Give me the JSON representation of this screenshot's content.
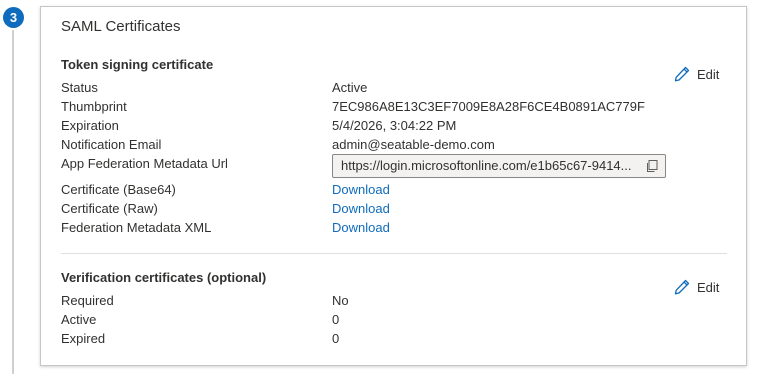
{
  "step": {
    "number": "3"
  },
  "card": {
    "title": "SAML Certificates"
  },
  "token_signing": {
    "title": "Token signing certificate",
    "edit_label": "Edit",
    "rows": [
      {
        "label": "Status",
        "value": "Active"
      },
      {
        "label": "Thumbprint",
        "value": "7EC986A8E13C3EF7009E8A28F6CE4B0891AC779F"
      },
      {
        "label": "Expiration",
        "value": "5/4/2026, 3:04:22 PM"
      },
      {
        "label": "Notification Email",
        "value": "admin@seatable-demo.com"
      }
    ],
    "metadata_url": {
      "label": "App Federation Metadata Url",
      "value": "https://login.microsoftonline.com/e1b65c67-9414..."
    },
    "downloads": [
      {
        "label": "Certificate (Base64)",
        "link": "Download"
      },
      {
        "label": "Certificate (Raw)",
        "link": "Download"
      },
      {
        "label": "Federation Metadata XML",
        "link": "Download"
      }
    ]
  },
  "verification": {
    "title": "Verification certificates (optional)",
    "edit_label": "Edit",
    "rows": [
      {
        "label": "Required",
        "value": "No"
      },
      {
        "label": "Active",
        "value": "0"
      },
      {
        "label": "Expired",
        "value": "0"
      }
    ]
  },
  "icons": {
    "edit": "pencil-icon",
    "copy": "copy-icon"
  },
  "colors": {
    "accent": "#0f6cbd",
    "text": "#323130"
  }
}
